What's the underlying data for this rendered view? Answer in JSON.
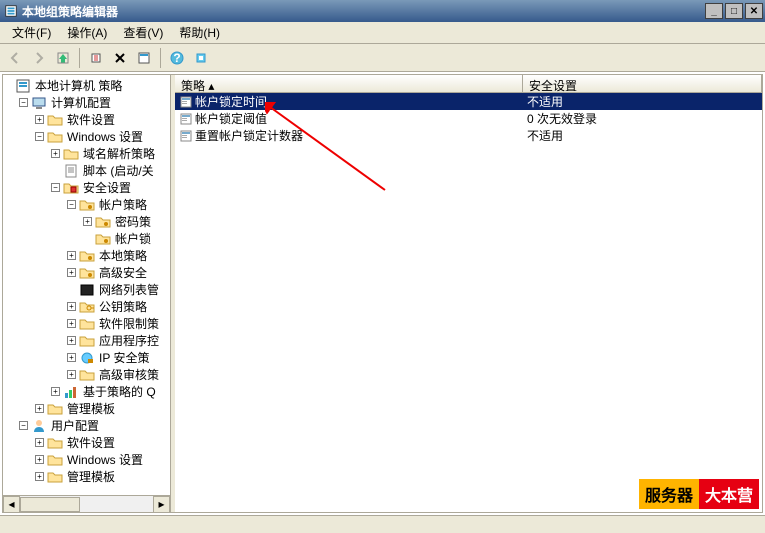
{
  "window": {
    "title": "本地组策略编辑器"
  },
  "menu": {
    "file": "文件(F)",
    "action": "操作(A)",
    "view": "查看(V)",
    "help": "帮助(H)"
  },
  "tree": [
    {
      "indent": 0,
      "toggle": "none",
      "icon": "policy",
      "label": "本地计算机 策略"
    },
    {
      "indent": 1,
      "toggle": "minus",
      "icon": "computer",
      "label": "计算机配置"
    },
    {
      "indent": 2,
      "toggle": "plus",
      "icon": "folder",
      "label": "软件设置"
    },
    {
      "indent": 2,
      "toggle": "minus",
      "icon": "folder",
      "label": "Windows 设置"
    },
    {
      "indent": 3,
      "toggle": "plus",
      "icon": "folder",
      "label": "域名解析策略"
    },
    {
      "indent": 3,
      "toggle": "none",
      "icon": "script",
      "label": "脚本 (启动/关"
    },
    {
      "indent": 3,
      "toggle": "minus",
      "icon": "security",
      "label": "安全设置"
    },
    {
      "indent": 4,
      "toggle": "minus",
      "icon": "folderlock",
      "label": "帐户策略"
    },
    {
      "indent": 5,
      "toggle": "plus",
      "icon": "folderlock",
      "label": "密码策"
    },
    {
      "indent": 5,
      "toggle": "none",
      "icon": "folderlock",
      "label": "帐户锁",
      "selected": true
    },
    {
      "indent": 4,
      "toggle": "plus",
      "icon": "folderlock",
      "label": "本地策略"
    },
    {
      "indent": 4,
      "toggle": "plus",
      "icon": "folderlock",
      "label": "高级安全"
    },
    {
      "indent": 4,
      "toggle": "none",
      "icon": "netlist",
      "label": "网络列表管"
    },
    {
      "indent": 4,
      "toggle": "plus",
      "icon": "folderkey",
      "label": "公钥策略"
    },
    {
      "indent": 4,
      "toggle": "plus",
      "icon": "folder",
      "label": "软件限制策"
    },
    {
      "indent": 4,
      "toggle": "plus",
      "icon": "folder",
      "label": "应用程序控"
    },
    {
      "indent": 4,
      "toggle": "plus",
      "icon": "ipsec",
      "label": "IP 安全策"
    },
    {
      "indent": 4,
      "toggle": "plus",
      "icon": "folder",
      "label": "高级审核策"
    },
    {
      "indent": 3,
      "toggle": "plus",
      "icon": "chart",
      "label": "基于策略的 Q"
    },
    {
      "indent": 2,
      "toggle": "plus",
      "icon": "folder",
      "label": "管理模板"
    },
    {
      "indent": 1,
      "toggle": "minus",
      "icon": "user",
      "label": "用户配置"
    },
    {
      "indent": 2,
      "toggle": "plus",
      "icon": "folder",
      "label": "软件设置"
    },
    {
      "indent": 2,
      "toggle": "plus",
      "icon": "folder",
      "label": "Windows 设置"
    },
    {
      "indent": 2,
      "toggle": "plus",
      "icon": "folder",
      "label": "管理模板"
    }
  ],
  "columns": {
    "policy": "策略",
    "setting": "安全设置"
  },
  "rows": [
    {
      "label": "帐户锁定时间",
      "value": "不适用",
      "selected": true
    },
    {
      "label": "帐户锁定阈值",
      "value": "0 次无效登录"
    },
    {
      "label": "重置帐户锁定计数器",
      "value": "不适用"
    }
  ],
  "watermark": {
    "part1": "服务器",
    "part2": "大本营"
  }
}
